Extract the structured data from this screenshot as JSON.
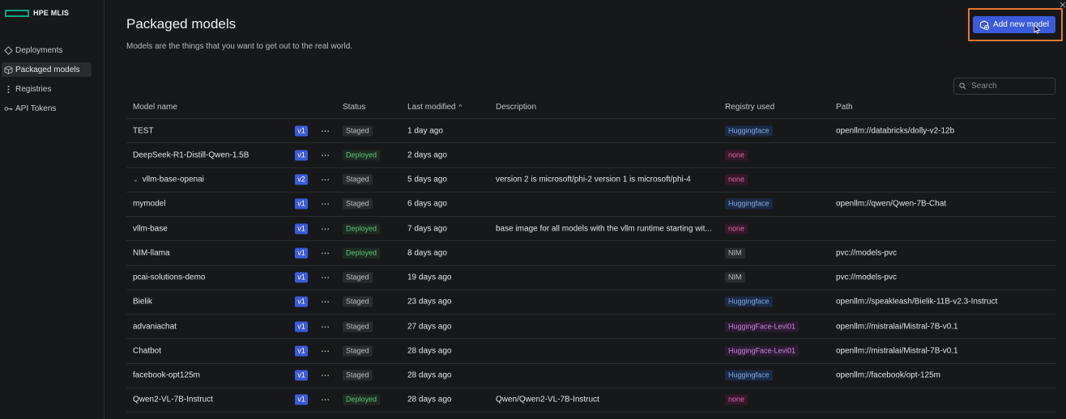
{
  "app": {
    "brand": "HPE MLIS",
    "accent": "#01a982"
  },
  "sidebar": {
    "items": [
      {
        "label": "Deployments",
        "icon": "tag-icon",
        "active": false
      },
      {
        "label": "Packaged models",
        "icon": "cube-icon",
        "active": true
      },
      {
        "label": "Registries",
        "icon": "vertical-dots-icon",
        "active": false
      },
      {
        "label": "API Tokens",
        "icon": "key-icon",
        "active": false
      }
    ]
  },
  "header": {
    "title": "Packaged models",
    "subtitle": "Models are the things that you want to get out to the real world.",
    "add_button": "Add new model",
    "add_button_color": "#3b5bdb",
    "highlight_color": "#e8772e"
  },
  "search": {
    "placeholder": "Search",
    "value": ""
  },
  "table": {
    "columns": {
      "name": "Model name",
      "status": "Status",
      "modified": "Last modified",
      "description": "Description",
      "registry": "Registry used",
      "path": "Path"
    },
    "rows": [
      {
        "name": "TEST",
        "version": "v1",
        "status": "Staged",
        "modified": "1 day ago",
        "description": "",
        "registry": "Huggingface",
        "path": "openllm://databricks/dolly-v2-12b"
      },
      {
        "name": "DeepSeek-R1-Distill-Qwen-1.5B",
        "version": "v1",
        "status": "Deployed",
        "modified": "2 days ago",
        "description": "",
        "registry": "none",
        "path": ""
      },
      {
        "name": "vllm-base-openai",
        "version": "v2",
        "status": "Staged",
        "modified": "5 days ago",
        "description": "version 2 is microsoft/phi-2 version 1 is microsoft/phi-4",
        "registry": "none",
        "path": "",
        "expandable": true
      },
      {
        "name": "mymodel",
        "version": "v1",
        "status": "Staged",
        "modified": "6 days ago",
        "description": "",
        "registry": "Huggingface",
        "path": "openllm://qwen/Qwen-7B-Chat"
      },
      {
        "name": "vllm-base",
        "version": "v1",
        "status": "Deployed",
        "modified": "7 days ago",
        "description": "base image for all models with the vllm runtime starting wit...",
        "registry": "none",
        "path": ""
      },
      {
        "name": "NIM-llama",
        "version": "v1",
        "status": "Deployed",
        "modified": "8 days ago",
        "description": "",
        "registry": "NIM",
        "path": "pvc://models-pvc"
      },
      {
        "name": "pcai-solutions-demo",
        "version": "v1",
        "status": "Staged",
        "modified": "19 days ago",
        "description": "",
        "registry": "NIM",
        "path": "pvc://models-pvc"
      },
      {
        "name": "Bielik",
        "version": "v1",
        "status": "Staged",
        "modified": "23 days ago",
        "description": "",
        "registry": "Huggingface",
        "path": "openllm://speakleash/Bielik-11B-v2.3-Instruct"
      },
      {
        "name": "advaniachat",
        "version": "v1",
        "status": "Staged",
        "modified": "27 days ago",
        "description": "",
        "registry": "HuggingFace-Levi01",
        "path": "openllm://mistralai/Mistral-7B-v0.1"
      },
      {
        "name": "Chatbot",
        "version": "v1",
        "status": "Staged",
        "modified": "28 days ago",
        "description": "",
        "registry": "HuggingFace-Levi01",
        "path": "openllm://mistralai/Mistral-7B-v0.1"
      },
      {
        "name": "facebook-opt125m",
        "version": "v1",
        "status": "Staged",
        "modified": "28 days ago",
        "description": "",
        "registry": "Huggingface",
        "path": "openllm://facebook/opt-125m"
      },
      {
        "name": "Qwen2-VL-7B-Instruct",
        "version": "v1",
        "status": "Deployed",
        "modified": "28 days ago",
        "description": "Qwen/Qwen2-VL-7B-Instruct",
        "registry": "none",
        "path": ""
      }
    ]
  }
}
